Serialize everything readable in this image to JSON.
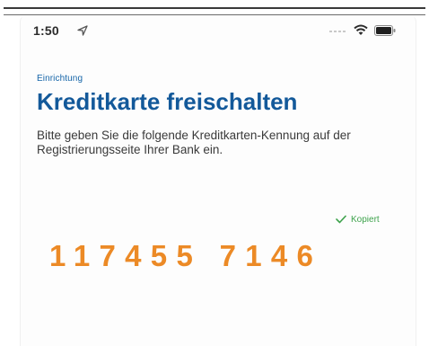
{
  "status_bar": {
    "time": "1:50",
    "icons": [
      "location-arrow-icon",
      "signal-icon",
      "wifi-icon",
      "battery-icon"
    ]
  },
  "screen": {
    "section_label": "Einrichtung",
    "title": "Kreditkarte freischalten",
    "description": "Bitte geben Sie die folgende Kreditkarten-Kennung auf der Registrierungsseite Ihrer Bank ein.",
    "copied_label": "Kopiert",
    "card_identifier": "117455 7146"
  },
  "colors": {
    "accent_blue": "#13599a",
    "label_blue": "#1565a8",
    "success_green": "#3fa34d",
    "identifier_orange": "#ec8a26",
    "body_text": "#3a3a3a"
  }
}
